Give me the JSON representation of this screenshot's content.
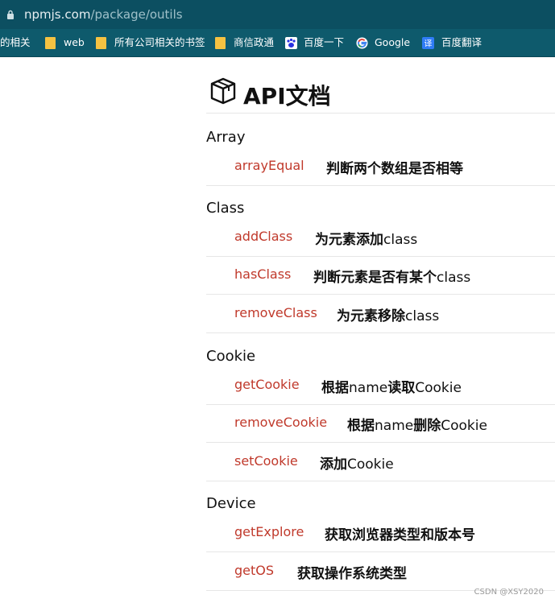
{
  "browser": {
    "url_host": "npmjs.com",
    "url_path": "/package/outils",
    "bookmarks": [
      {
        "label": "的相关",
        "icon": "none"
      },
      {
        "label": "web",
        "icon": "folder-icon"
      },
      {
        "label": "所有公司相关的书签",
        "icon": "folder-icon"
      },
      {
        "label": "商信政通",
        "icon": "folder-icon"
      },
      {
        "label": "百度一下",
        "icon": "baidu-paw-icon"
      },
      {
        "label": "Google",
        "icon": "google-g-icon"
      },
      {
        "label": "百度翻译",
        "icon": "translate-icon"
      }
    ]
  },
  "page": {
    "title": "API文档",
    "sections": [
      {
        "name": "Array",
        "items": [
          {
            "fn": "arrayEqual",
            "desc": "判断两个数组是否相等"
          }
        ]
      },
      {
        "name": "Class",
        "items": [
          {
            "fn": "addClass",
            "desc_cn": "为元素添加",
            "desc_en": "class"
          },
          {
            "fn": "hasClass",
            "desc_cn": "判断元素是否有某个",
            "desc_en": "class"
          },
          {
            "fn": "removeClass",
            "desc_cn": "为元素移除",
            "desc_en": "class"
          }
        ]
      },
      {
        "name": "Cookie",
        "items": [
          {
            "fn": "getCookie",
            "d1": "根据",
            "d2": "name",
            "d3": "读取",
            "d4": "Cookie"
          },
          {
            "fn": "removeCookie",
            "d1": "根据",
            "d2": "name",
            "d3": "删除",
            "d4": "Cookie"
          },
          {
            "fn": "setCookie",
            "d1": "添加",
            "d4": "Cookie"
          }
        ]
      },
      {
        "name": "Device",
        "items": [
          {
            "fn": "getExplore",
            "desc": "获取浏览器类型和版本号"
          },
          {
            "fn": "getOS",
            "desc": "获取操作系统类型"
          }
        ]
      }
    ]
  },
  "watermark": "CSDN @XSY2020",
  "colors": {
    "addressbar": "#0c4f61",
    "bookmarkbar": "#0e5a6c",
    "function_link": "#c0392b"
  }
}
